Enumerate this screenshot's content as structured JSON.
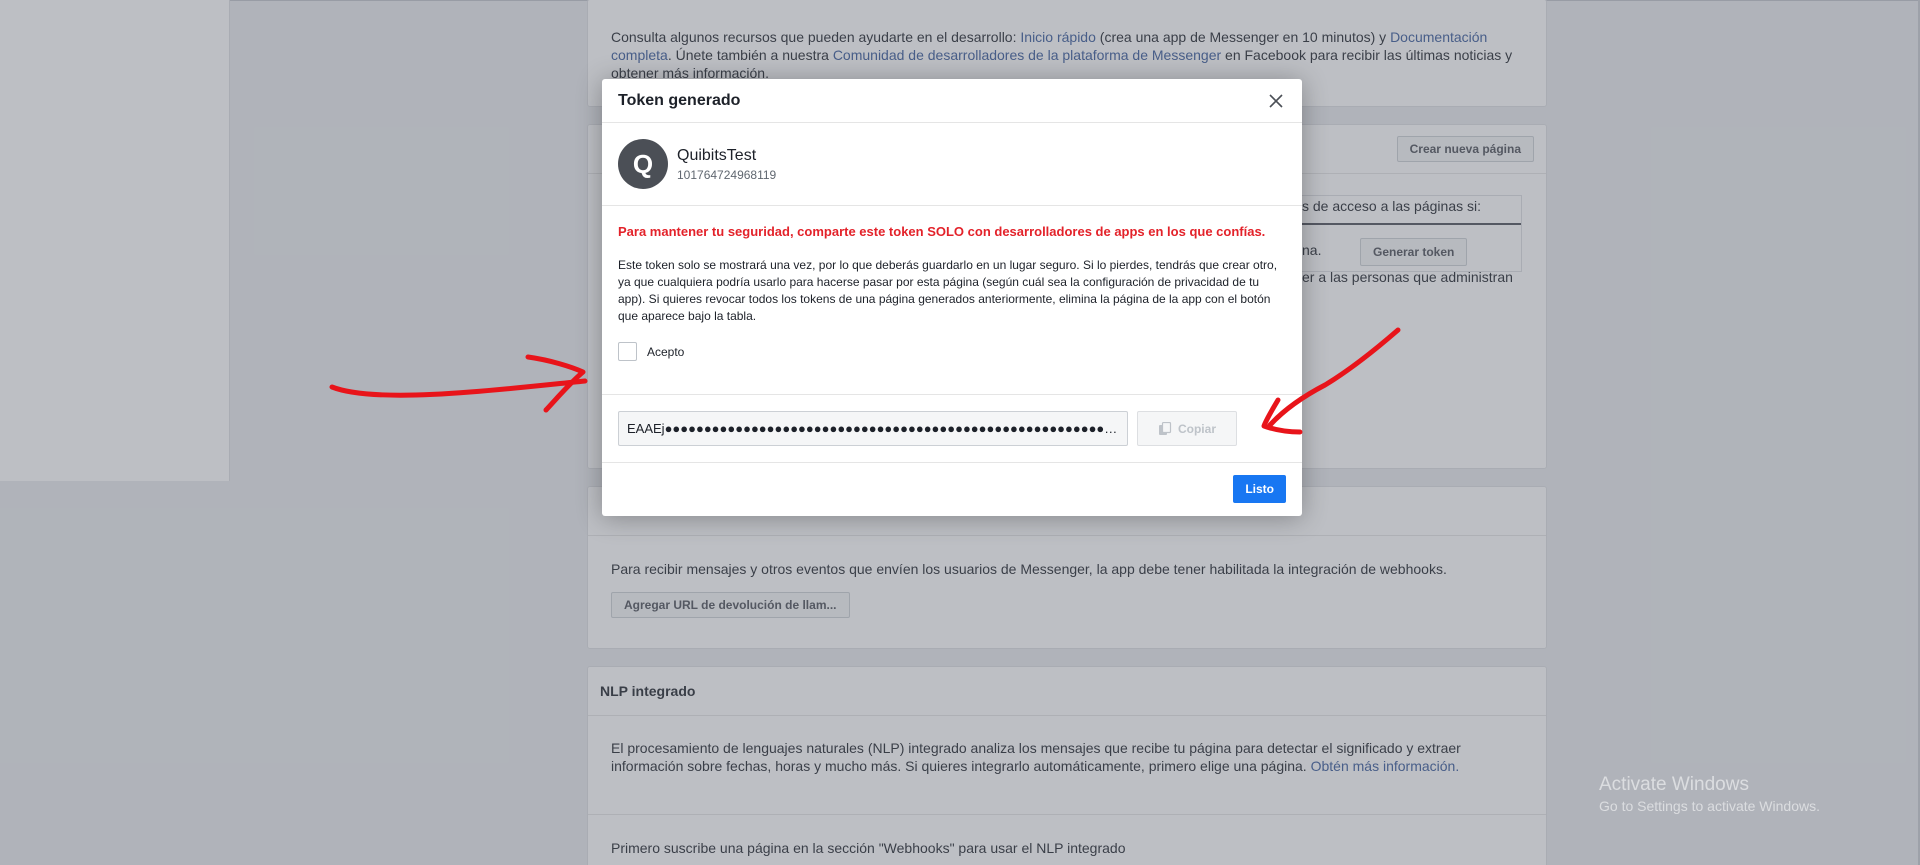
{
  "background": {
    "resources_card": {
      "text_before": "Consulta algunos recursos que pueden ayudarte en el desarrollo: ",
      "link_quickstart": "Inicio rápido",
      "text_mid": " (crea una app de Messenger en 10 minutos) y ",
      "link_docs": "Documentación completa",
      "text_mid2": ". Únete también a nuestra ",
      "link_community": "Comunidad de desarrolladores de la plataforma de Messenger",
      "text_after": " en Facebook para recibir las últimas noticias y obtener más información."
    },
    "tokens_card": {
      "create_page_button": "Crear nueva página",
      "partial_text_1": "s de acceso a las páginas si:",
      "partial_text_2": "na.",
      "partial_text_3": "er a las personas que administran",
      "generate_token_button": "Generar token"
    },
    "webhooks_card": {
      "description": "Para recibir mensajes y otros eventos que envíen los usuarios de Messenger, la app debe tener habilitada la integración de webhooks.",
      "callback_button": "Agregar URL de devolución de llam..."
    },
    "nlp_card": {
      "title": "NLP integrado",
      "description_before": "El procesamiento de lenguajes naturales (NLP) integrado analiza los mensajes que recibe tu página para detectar el significado y extraer información sobre fechas, horas y mucho más. Si quieres integrarlo automáticamente, primero elige una página. ",
      "link_more": "Obtén más información.",
      "footer_text": "Primero suscribe una página en la sección \"Webhooks\" para usar el NLP integrado"
    }
  },
  "modal": {
    "title": "Token generado",
    "page": {
      "avatar_letter": "Q",
      "name": "QuibitsTest",
      "id": "101764724968119"
    },
    "warning": "Para mantener tu seguridad, comparte este token SOLO con desarrolladores de apps en los que confías.",
    "info": "Este token solo se mostrará una vez, por lo que deberás guardarlo en un lugar seguro. Si lo pierdes, tendrás que crear otro, ya que cualquiera podría usarlo para hacerse pasar por esta página (según cuál sea la configuración de privacidad de tu app). Si quieres revocar todos los tokens de una página generados anteriormente, elimina la página de la app con el botón que aparece bajo la tabla.",
    "accept_label": "Acepto",
    "accept_checked": false,
    "token_value": "EAAEj●●●●●●●●●●●●●●●●●●●●●●●●●●●●●●●●●●●●●●●●●●●●●●●●●●●●●●●●●●●●●●●●●●●●●●●●",
    "copy_label": "Copiar",
    "done_label": "Listo"
  },
  "watermark": {
    "title": "Activate Windows",
    "subtitle": "Go to Settings to activate Windows."
  },
  "colors": {
    "warning": "#e3222a",
    "primary_button": "#1877f2",
    "link": "#365899",
    "annotation": "#e8141a"
  }
}
